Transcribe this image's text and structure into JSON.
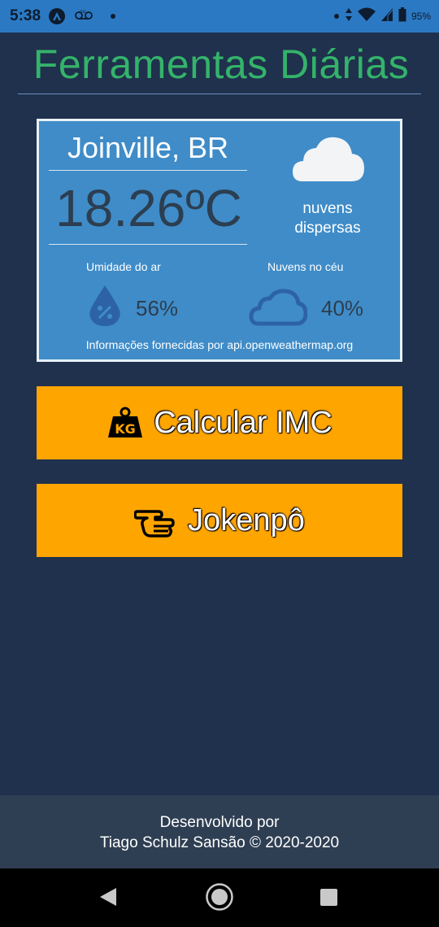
{
  "status_bar": {
    "time": "5:38",
    "battery": "95%"
  },
  "header": {
    "title": "Ferramentas Diárias"
  },
  "weather": {
    "city": "Joinville, BR",
    "temperature": "18.26ºC",
    "condition_line1": "nuvens",
    "condition_line2": "dispersas",
    "humidity_label": "Umidade do ar",
    "humidity_value": "56%",
    "clouds_label": "Nuvens no céu",
    "clouds_value": "40%",
    "credits": "Informações fornecidas por api.openweathermap.org"
  },
  "actions": {
    "imc_label": "Calcular IMC",
    "jokenpo_label": "Jokenpô",
    "kg_text": "KG"
  },
  "footer": {
    "line1": "Desenvolvido por",
    "line2": "Tiago Schulz Sansão © 2020-2020"
  },
  "colors": {
    "status_bar": "#2b79c3",
    "background": "#1f314d",
    "title": "#34b36a",
    "card": "#3f8cc8",
    "button": "#ffa500",
    "footer": "#2f3f53"
  },
  "icons": {
    "weather": "cloud-icon",
    "humidity": "water-drop-percent-icon",
    "clouds": "cloud-outline-icon",
    "imc": "weight-kg-icon",
    "jokenpo": "hand-pointing-icon"
  }
}
